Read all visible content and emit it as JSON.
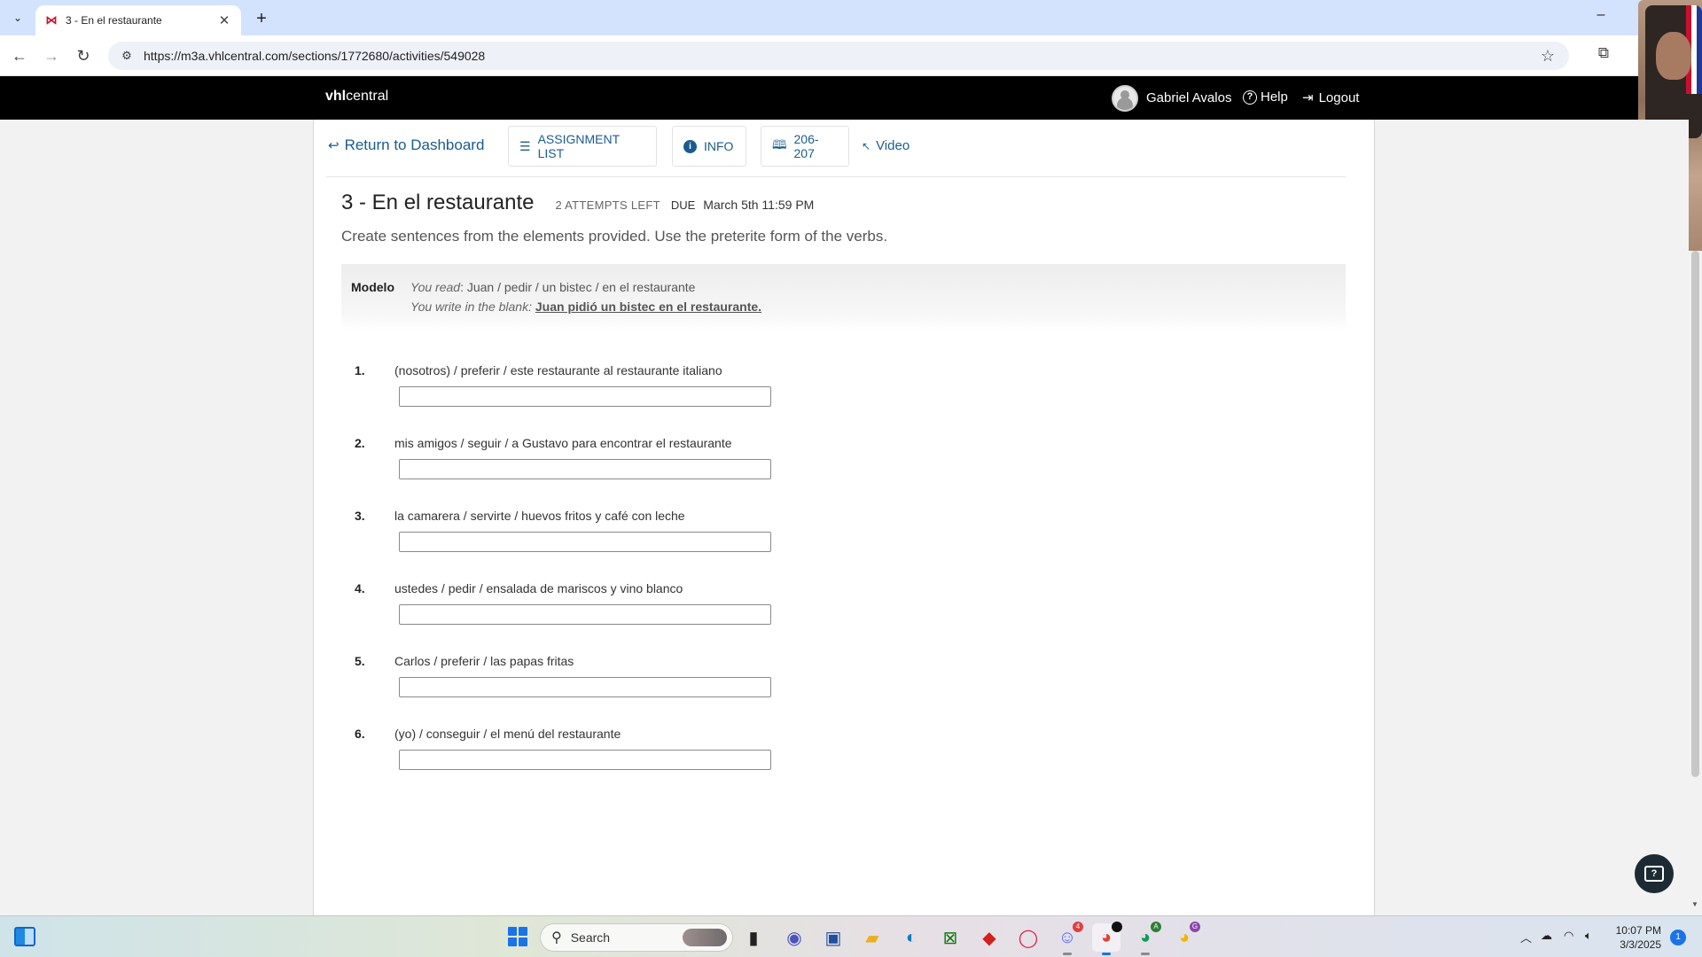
{
  "browser": {
    "tab_title": "3 - En el restaurante",
    "url": "https://m3a.vhlcentral.com/sections/1772680/activities/549028"
  },
  "header": {
    "brand_bold": "vhl",
    "brand_light": "central",
    "user_name": "Gabriel Avalos",
    "help_label": "Help",
    "logout_label": "Logout"
  },
  "activity_nav": {
    "return_label": "Return to Dashboard",
    "assignment_list_label": "ASSIGNMENT LIST",
    "info_label": "INFO",
    "pages_label": "206-207",
    "video_label": "Video"
  },
  "activity": {
    "title": "3 - En el restaurante",
    "attempts_left": "2 ATTEMPTS LEFT",
    "due_label": "DUE",
    "due_date": "March 5th 11:59 PM",
    "instructions": "Create sentences from the elements provided. Use the preterite form of the verbs."
  },
  "modelo": {
    "label": "Modelo",
    "read_label": "You read",
    "read_text": ": Juan / pedir / un bistec / en el restaurante",
    "write_label": "You write in the blank",
    "write_colon": ": ",
    "write_answer": "Juan pidió un bistec en el restaurante."
  },
  "items": [
    {
      "num": "1.",
      "prompt": "(nosotros) / preferir / este restaurante al restaurante italiano",
      "value": ""
    },
    {
      "num": "2.",
      "prompt": "mis amigos / seguir / a Gustavo para encontrar el restaurante",
      "value": ""
    },
    {
      "num": "3.",
      "prompt": "la camarera / servirte / huevos fritos y café con leche",
      "value": ""
    },
    {
      "num": "4.",
      "prompt": "ustedes / pedir / ensalada de mariscos y vino blanco",
      "value": ""
    },
    {
      "num": "5.",
      "prompt": "Carlos / preferir / las papas fritas",
      "value": ""
    },
    {
      "num": "6.",
      "prompt": "(yo) / conseguir / el menú del restaurante",
      "value": ""
    }
  ],
  "taskbar": {
    "search_placeholder": "Search",
    "clock_time": "10:07 PM",
    "clock_date": "3/3/2025",
    "notification_count": "1",
    "discord_badge": "4",
    "chrome_profile_badge": "A",
    "chrome_profile_badge_2": "G"
  },
  "colors": {
    "link_blue": "#1a5c8e",
    "header_black": "#000000",
    "windows_blue": "#1a73e8"
  }
}
